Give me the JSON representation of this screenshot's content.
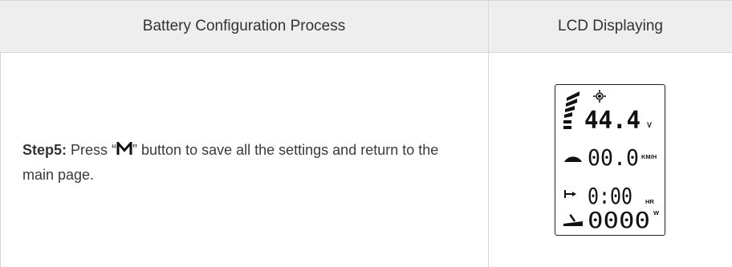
{
  "table": {
    "header_left": "Battery Configuration Process",
    "header_right": "LCD Displaying"
  },
  "step": {
    "label": "Step5:",
    "text_before": " Press “",
    "button_key": "M",
    "text_after": "” button to save all the settings and return to the main page."
  },
  "lcd": {
    "voltage": "44.4",
    "voltage_unit": "V",
    "speed": "00.0",
    "speed_unit": "KM/H",
    "trip_time": "0:00",
    "time_unit": "HR",
    "odometer": "0000",
    "power_unit": "W"
  }
}
